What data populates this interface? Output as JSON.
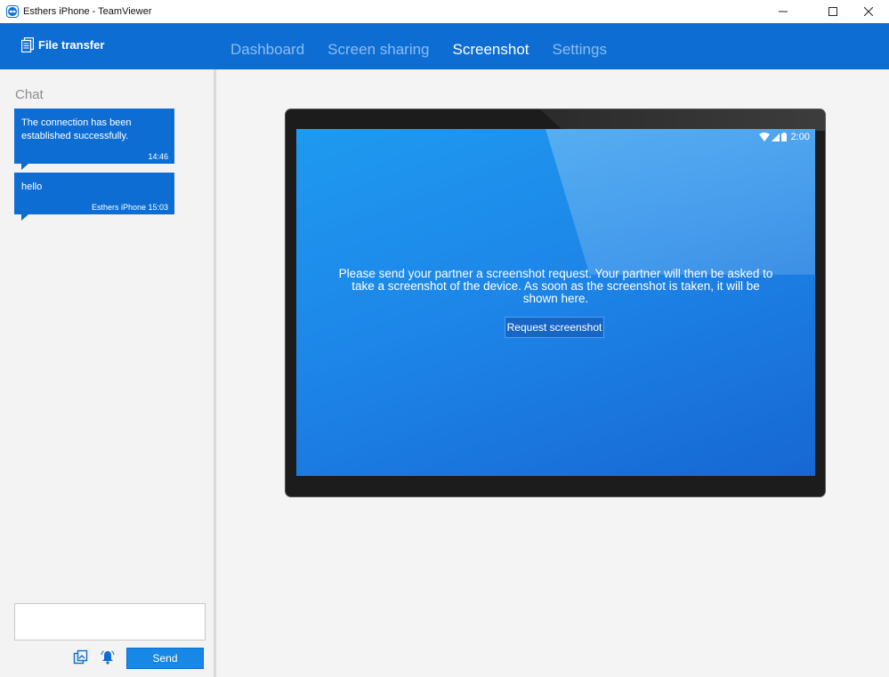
{
  "window": {
    "title": "Esthers iPhone - TeamViewer"
  },
  "topbar": {
    "file_transfer_label": "File transfer",
    "nav": [
      {
        "label": "Dashboard",
        "active": false
      },
      {
        "label": "Screen sharing",
        "active": false
      },
      {
        "label": "Screenshot",
        "active": true
      },
      {
        "label": "Settings",
        "active": false
      }
    ]
  },
  "chat": {
    "title": "Chat",
    "messages": [
      {
        "text": "The connection has been established successfully.",
        "meta": "14:46"
      },
      {
        "text": "hello",
        "meta": "Esthers iPhone 15:03"
      }
    ],
    "input_value": "",
    "send_label": "Send"
  },
  "device": {
    "status_time": "2:00",
    "message": "Please send your partner a screenshot request. Your partner will then be asked to take a screenshot of the device. As soon as the screenshot is taken, it will be shown here.",
    "request_button_label": "Request screenshot"
  },
  "colors": {
    "brand_blue": "#0e6dd3",
    "screen_blue": "#1d86e8",
    "nav_inactive": "#8cbcf0"
  }
}
